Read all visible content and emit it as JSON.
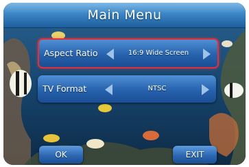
{
  "menu": {
    "title": "Main Menu"
  },
  "settings": [
    {
      "label": "Aspect Ratio",
      "value": "16:9 Wide Screen",
      "selected": true
    },
    {
      "label": "TV Format",
      "value": "NTSC",
      "selected": false
    }
  ],
  "buttons": {
    "ok_label": "OK",
    "exit_label": "EXIT"
  },
  "colors": {
    "title_bar": "#3b86c6",
    "row_bg": "#2662ad",
    "selection_border": "#e0303a",
    "arrow": "#9fc3e8"
  },
  "icons": [
    "arrow-left-icon",
    "arrow-right-icon"
  ]
}
